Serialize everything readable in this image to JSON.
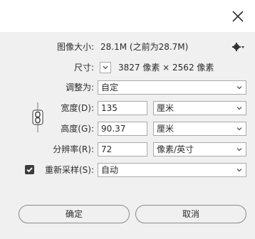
{
  "dialog": {
    "close_glyph": "✕"
  },
  "image_size": {
    "label": "图像大小:",
    "value": "28.1M (之前为28.7M)"
  },
  "dimensions": {
    "label": "尺寸:",
    "value": "3827 像素  ×  2562 像素"
  },
  "adjust_to": {
    "label": "调整为:",
    "value": "自定"
  },
  "width": {
    "label": "宽度(D):",
    "value": "135",
    "unit": "厘米"
  },
  "height": {
    "label": "高度(G):",
    "value": "90.37",
    "unit": "厘米"
  },
  "resolution": {
    "label": "分辨率(R):",
    "value": "72",
    "unit": "像素/英寸"
  },
  "resample": {
    "label": "重新采样(S):",
    "checked": true,
    "value": "自动"
  },
  "buttons": {
    "ok": "确定",
    "cancel": "取消"
  },
  "icons": {
    "close": "close-icon",
    "settings": "gear-icon",
    "link": "chain-link-icon"
  }
}
